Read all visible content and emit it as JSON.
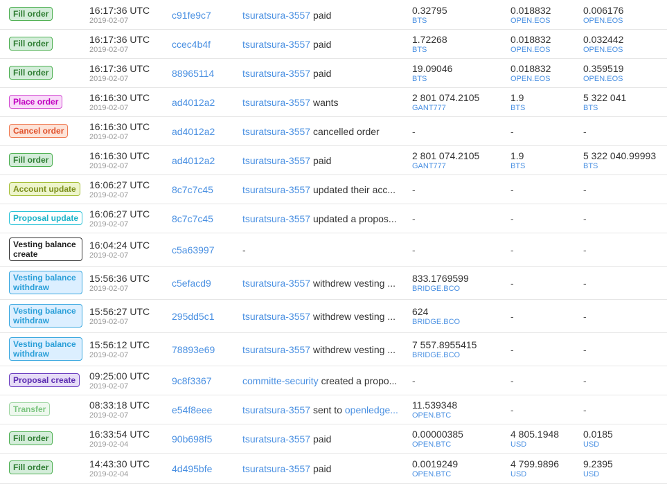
{
  "rows": [
    {
      "type": "Fill order",
      "style": "fill",
      "time": "16:17:36 UTC",
      "date": "2019-02-07",
      "hash": "c91fe9c7",
      "user": "tsuratsura-3557",
      "desc": "paid",
      "extra": "",
      "a1": "0.32795",
      "a1asset": "BTS",
      "a2": "0.018832",
      "a2asset": "OPEN.EOS",
      "a3": "0.006176",
      "a3asset": "OPEN.EOS"
    },
    {
      "type": "Fill order",
      "style": "fill",
      "time": "16:17:36 UTC",
      "date": "2019-02-07",
      "hash": "ccec4b4f",
      "user": "tsuratsura-3557",
      "desc": "paid",
      "extra": "",
      "a1": "1.72268",
      "a1asset": "BTS",
      "a2": "0.018832",
      "a2asset": "OPEN.EOS",
      "a3": "0.032442",
      "a3asset": "OPEN.EOS"
    },
    {
      "type": "Fill order",
      "style": "fill",
      "time": "16:17:36 UTC",
      "date": "2019-02-07",
      "hash": "88965114",
      "user": "tsuratsura-3557",
      "desc": "paid",
      "extra": "",
      "a1": "19.09046",
      "a1asset": "BTS",
      "a2": "0.018832",
      "a2asset": "OPEN.EOS",
      "a3": "0.359519",
      "a3asset": "OPEN.EOS"
    },
    {
      "type": "Place order",
      "style": "place",
      "time": "16:16:30 UTC",
      "date": "2019-02-07",
      "hash": "ad4012a2",
      "user": "tsuratsura-3557",
      "desc": "wants",
      "extra": "",
      "a1": "2 801 074.2105",
      "a1asset": "GANT777",
      "a2": "1.9",
      "a2asset": "BTS",
      "a3": "5 322 041",
      "a3asset": "BTS"
    },
    {
      "type": "Cancel order",
      "style": "cancel",
      "time": "16:16:30 UTC",
      "date": "2019-02-07",
      "hash": "ad4012a2",
      "user": "tsuratsura-3557",
      "desc": "cancelled order",
      "extra": "",
      "a1": "-",
      "a1asset": "",
      "a2": "-",
      "a2asset": "",
      "a3": "-",
      "a3asset": ""
    },
    {
      "type": "Fill order",
      "style": "fill",
      "time": "16:16:30 UTC",
      "date": "2019-02-07",
      "hash": "ad4012a2",
      "user": "tsuratsura-3557",
      "desc": "paid",
      "extra": "",
      "a1": "2 801 074.2105",
      "a1asset": "GANT777",
      "a2": "1.9",
      "a2asset": "BTS",
      "a3": "5 322 040.99993",
      "a3asset": "BTS"
    },
    {
      "type": "Account update",
      "style": "account",
      "time": "16:06:27 UTC",
      "date": "2019-02-07",
      "hash": "8c7c7c45",
      "user": "tsuratsura-3557",
      "desc": "updated their acc...",
      "extra": "",
      "a1": "-",
      "a1asset": "",
      "a2": "-",
      "a2asset": "",
      "a3": "-",
      "a3asset": ""
    },
    {
      "type": "Proposal update",
      "style": "propupd",
      "time": "16:06:27 UTC",
      "date": "2019-02-07",
      "hash": "8c7c7c45",
      "user": "tsuratsura-3557",
      "desc": "updated a propos...",
      "extra": "",
      "a1": "-",
      "a1asset": "",
      "a2": "-",
      "a2asset": "",
      "a3": "-",
      "a3asset": ""
    },
    {
      "type": "Vesting balance create",
      "style": "vcreate",
      "time": "16:04:24 UTC",
      "date": "2019-02-07",
      "hash": "c5a63997",
      "user": "",
      "desc": "-",
      "extra": "",
      "a1": "-",
      "a1asset": "",
      "a2": "-",
      "a2asset": "",
      "a3": "-",
      "a3asset": ""
    },
    {
      "type": "Vesting balance withdraw",
      "style": "vwithdraw",
      "time": "15:56:36 UTC",
      "date": "2019-02-07",
      "hash": "c5efacd9",
      "user": "tsuratsura-3557",
      "desc": "withdrew vesting ...",
      "extra": "",
      "a1": "833.1769599",
      "a1asset": "BRIDGE.BCO",
      "a2": "-",
      "a2asset": "",
      "a3": "-",
      "a3asset": ""
    },
    {
      "type": "Vesting balance withdraw",
      "style": "vwithdraw",
      "time": "15:56:27 UTC",
      "date": "2019-02-07",
      "hash": "295dd5c1",
      "user": "tsuratsura-3557",
      "desc": "withdrew vesting ...",
      "extra": "",
      "a1": "624",
      "a1asset": "BRIDGE.BCO",
      "a2": "-",
      "a2asset": "",
      "a3": "-",
      "a3asset": ""
    },
    {
      "type": "Vesting balance withdraw",
      "style": "vwithdraw",
      "time": "15:56:12 UTC",
      "date": "2019-02-07",
      "hash": "78893e69",
      "user": "tsuratsura-3557",
      "desc": "withdrew vesting ...",
      "extra": "",
      "a1": "7 557.8955415",
      "a1asset": "BRIDGE.BCO",
      "a2": "-",
      "a2asset": "",
      "a3": "-",
      "a3asset": ""
    },
    {
      "type": "Proposal create",
      "style": "propcreate",
      "time": "09:25:00 UTC",
      "date": "2019-02-07",
      "hash": "9c8f3367",
      "user": "committe-security",
      "desc": "created a propo...",
      "extra": "",
      "a1": "-",
      "a1asset": "",
      "a2": "-",
      "a2asset": "",
      "a3": "-",
      "a3asset": ""
    },
    {
      "type": "Transfer",
      "style": "transfer",
      "time": "08:33:18 UTC",
      "date": "2019-02-07",
      "hash": "e54f8eee",
      "user": "tsuratsura-3557",
      "desc": "sent to",
      "extra": "openledge...",
      "a1": "11.539348",
      "a1asset": "OPEN.BTC",
      "a2": "-",
      "a2asset": "",
      "a3": "-",
      "a3asset": ""
    },
    {
      "type": "Fill order",
      "style": "fill",
      "time": "16:33:54 UTC",
      "date": "2019-02-04",
      "hash": "90b698f5",
      "user": "tsuratsura-3557",
      "desc": "paid",
      "extra": "",
      "a1": "0.00000385",
      "a1asset": "OPEN.BTC",
      "a2": "4 805.1948",
      "a2asset": "USD",
      "a3": "0.0185",
      "a3asset": "USD"
    },
    {
      "type": "Fill order",
      "style": "fill",
      "time": "14:43:30 UTC",
      "date": "2019-02-04",
      "hash": "4d495bfe",
      "user": "tsuratsura-3557",
      "desc": "paid",
      "extra": "",
      "a1": "0.0019249",
      "a1asset": "OPEN.BTC",
      "a2": "4 799.9896",
      "a2asset": "USD",
      "a3": "9.2395",
      "a3asset": "USD"
    }
  ],
  "badge_styles": {
    "fill": {
      "color": "#2e7d32",
      "bg": "#d4edda",
      "border": "#4caf50"
    },
    "place": {
      "color": "#c000c0",
      "bg": "#f9dcf9",
      "border": "#d24bd2"
    },
    "cancel": {
      "color": "#e0502a",
      "bg": "#fde3d8",
      "border": "#f07a52"
    },
    "account": {
      "color": "#7a8f1a",
      "bg": "#eef5cc",
      "border": "#a6bf3a"
    },
    "propupd": {
      "color": "#1ab3c8",
      "bg": "#ffffff",
      "border": "#2cc3d8"
    },
    "vcreate": {
      "color": "#222222",
      "bg": "#ffffff",
      "border": "#333333"
    },
    "vwithdraw": {
      "color": "#2a9fd8",
      "bg": "#dcefff",
      "border": "#3aa8e0"
    },
    "propcreate": {
      "color": "#5b2cb0",
      "bg": "#e6dcf7",
      "border": "#6a3cc0"
    },
    "transfer": {
      "color": "#7bc47f",
      "bg": "#eef8ee",
      "border": "#9fd6a2"
    }
  }
}
